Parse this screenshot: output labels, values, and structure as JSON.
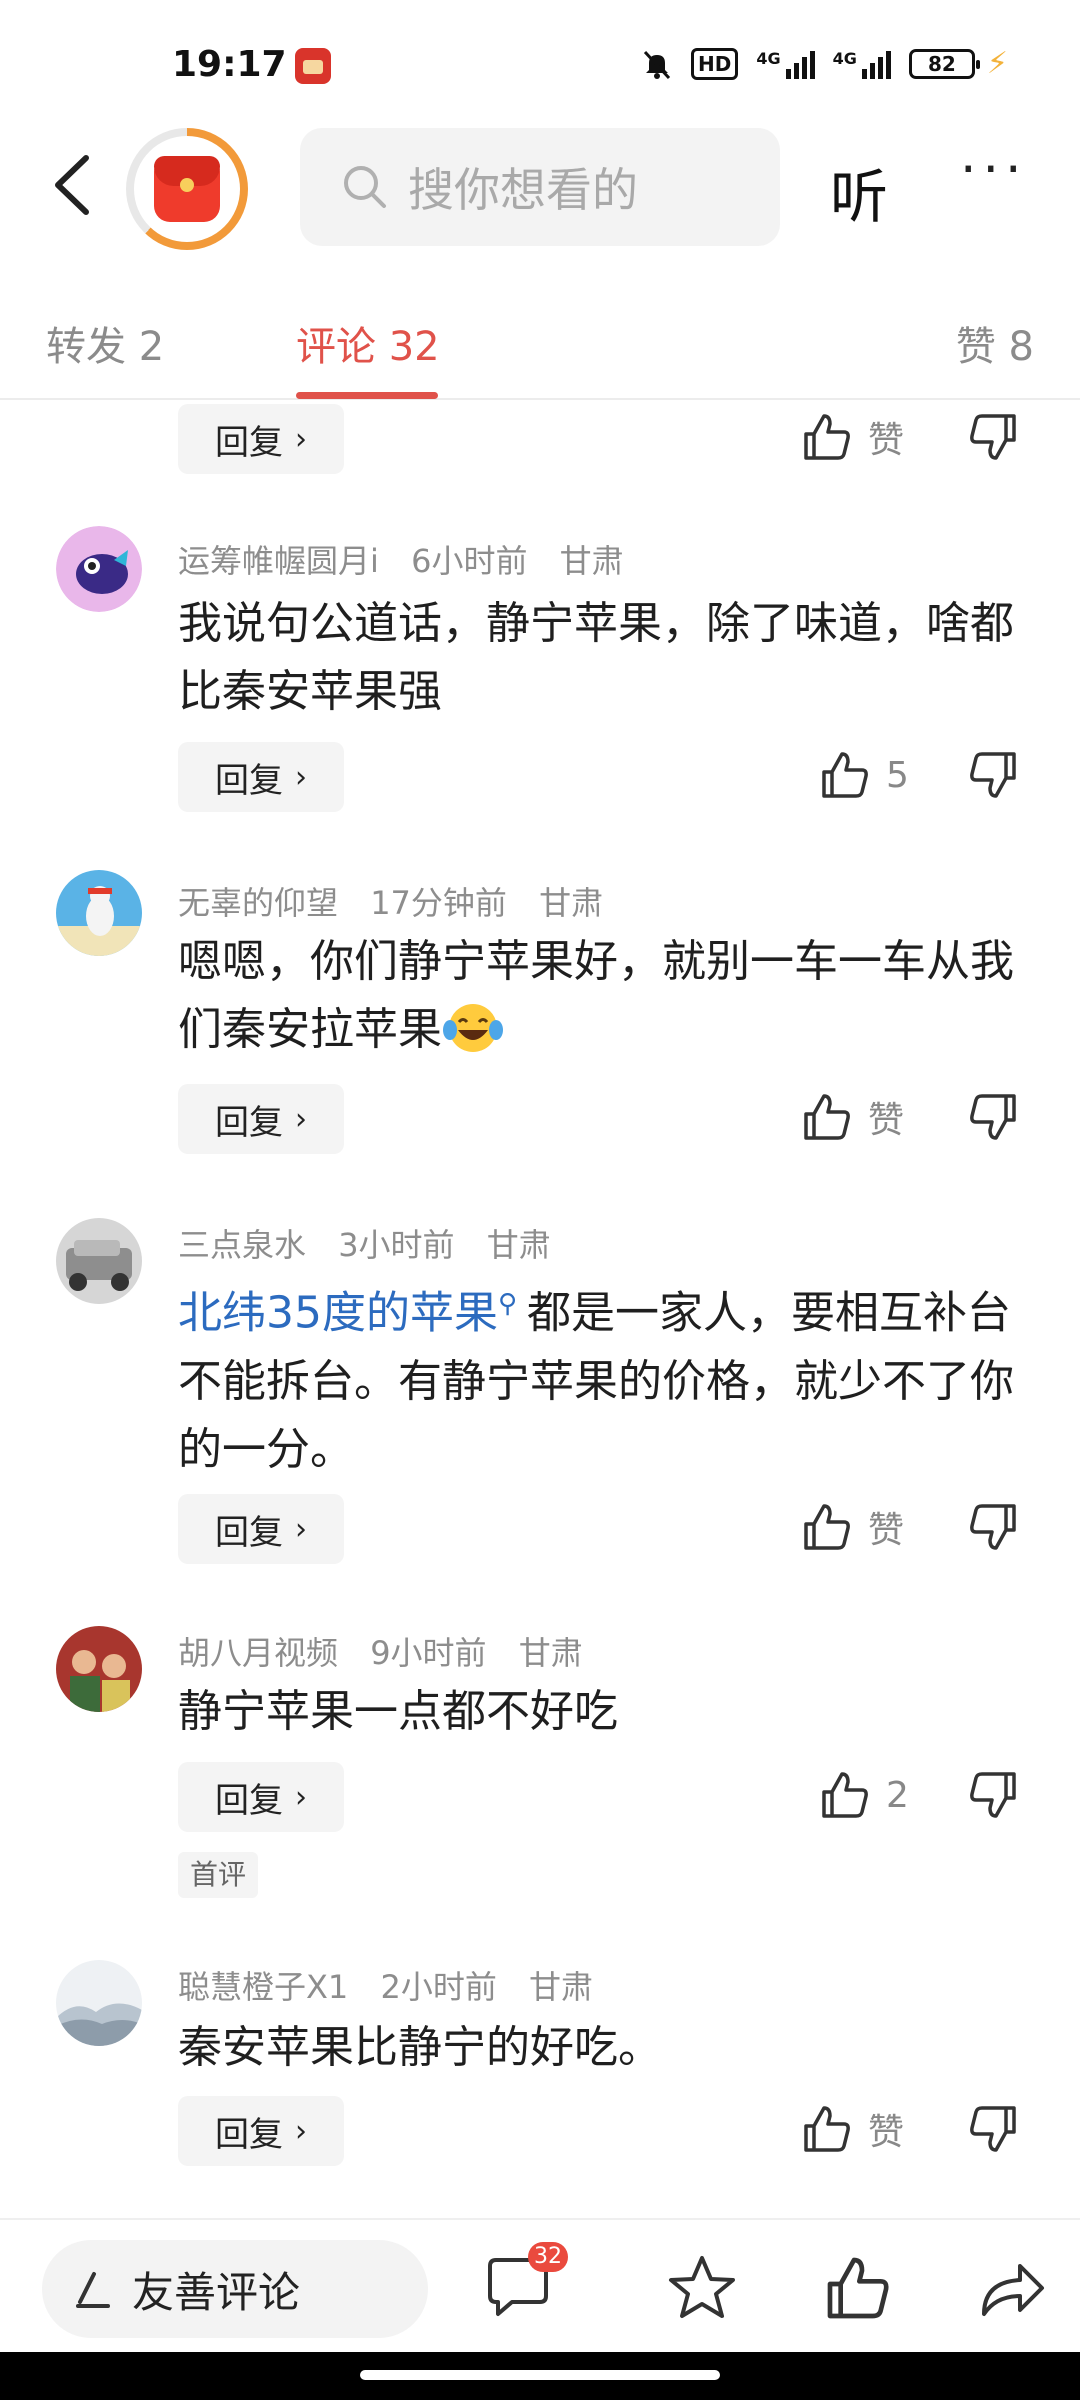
{
  "status_bar": {
    "time": "19:17",
    "hd_label": "HD",
    "network_1": "4G",
    "network_2": "4G",
    "battery": "82"
  },
  "header": {
    "search_placeholder": "搜你想看的",
    "listen_label": "听",
    "more_label": "···"
  },
  "tabs": {
    "forward": "转发 2",
    "comments": "评论 32",
    "likes": "赞 8"
  },
  "comments": {
    "top_partial": {
      "reply_label": "回复",
      "like_label": "赞"
    },
    "items": [
      {
        "username": "运筹帷幄圆月i",
        "time": "6小时前",
        "location": "甘肃",
        "text": "我说句公道话，静宁苹果，除了味道，啥都比秦安苹果强",
        "reply_label": "回复",
        "like_label": "5"
      },
      {
        "username": "无辜的仰望",
        "time": "17分钟前",
        "location": "甘肃",
        "text": "嗯嗯，你们静宁苹果好，就别一车一车从我们秦安拉苹果",
        "emoji": "laughing-tears",
        "reply_label": "回复",
        "like_label": "赞"
      },
      {
        "username": "三点泉水",
        "time": "3小时前",
        "location": "甘肃",
        "topic": "北纬35度的苹果",
        "text": "都是一家人，要相互补台不能拆台。有静宁苹果的价格，就少不了你的一分。",
        "reply_label": "回复",
        "like_label": "赞"
      },
      {
        "username": "胡八月视频",
        "time": "9小时前",
        "location": "甘肃",
        "text": "静宁苹果一点都不好吃",
        "reply_label": "回复",
        "like_label": "2",
        "badge": "首评"
      },
      {
        "username": "聪慧橙子X1",
        "time": "2小时前",
        "location": "甘肃",
        "text": "秦安苹果比静宁的好吃。",
        "reply_label": "回复",
        "like_label": "赞"
      }
    ]
  },
  "bottom_bar": {
    "input_label": "友善评论",
    "comment_count": "32"
  },
  "colors": {
    "accent": "#e0524a",
    "link": "#2c6bbf",
    "muted": "#8d8d8d"
  },
  "icons": [
    "back-icon",
    "red-pocket-icon",
    "search-icon",
    "thumb-up-icon",
    "thumb-down-icon",
    "chevron-right-icon",
    "pen-icon",
    "comment-icon",
    "star-icon",
    "share-icon"
  ]
}
